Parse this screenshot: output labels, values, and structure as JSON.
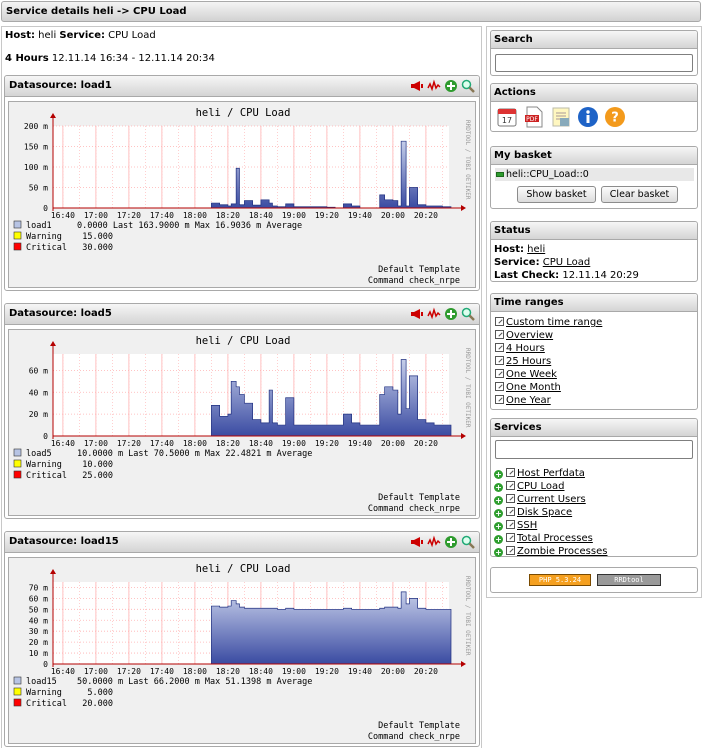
{
  "header": {
    "title": "Service details heli -> CPU Load"
  },
  "host": {
    "host_label": "Host:",
    "host_value": "heli",
    "service_label": "Service:",
    "service_value": "CPU Load"
  },
  "range": {
    "label": "4 Hours",
    "value": "12.11.14 16:34 - 12.11.14 20:34"
  },
  "datasources": [
    {
      "title": "Datasource: load1",
      "graph_title": "heli / CPU Load",
      "side_label": "RRDTOOL / TOBI OETIKER",
      "legend": [
        {
          "name": "load1",
          "color": "#b7c4e4",
          "text": "0.0000   Last   163.9000 m Max   16.9036 m Average"
        },
        {
          "name": "Warning",
          "color": "#ffff00",
          "text": "15.000"
        },
        {
          "name": "Critical",
          "color": "#ff0000",
          "text": "30.000"
        }
      ],
      "template": "Default Template",
      "command": "Command check_nrpe"
    },
    {
      "title": "Datasource: load5",
      "graph_title": "heli / CPU Load",
      "side_label": "RRDTOOL / TOBI OETIKER",
      "legend": [
        {
          "name": "load5",
          "color": "#b7c4e4",
          "text": "10.0000 m Last   70.5000 m Max   22.4821 m Average"
        },
        {
          "name": "Warning",
          "color": "#ffff00",
          "text": "10.000"
        },
        {
          "name": "Critical",
          "color": "#ff0000",
          "text": "25.000"
        }
      ],
      "template": "Default Template",
      "command": "Command check_nrpe"
    },
    {
      "title": "Datasource: load15",
      "graph_title": "heli / CPU Load",
      "side_label": "RRDTOOL / TOBI OETIKER",
      "legend": [
        {
          "name": "load15",
          "color": "#b7c4e4",
          "text": "50.0000 m Last   66.2000 m Max   51.1398 m Average"
        },
        {
          "name": "Warning",
          "color": "#ffff00",
          "text": "5.000"
        },
        {
          "name": "Critical",
          "color": "#ff0000",
          "text": "20.000"
        }
      ],
      "template": "Default Template",
      "command": "Command check_nrpe"
    }
  ],
  "chart_data": [
    {
      "type": "area",
      "title": "heli / CPU Load",
      "x_ticks": [
        "16:40",
        "17:00",
        "17:20",
        "17:40",
        "18:00",
        "18:20",
        "18:40",
        "19:00",
        "19:20",
        "19:40",
        "20:00",
        "20:20"
      ],
      "y_ticks": [
        "0",
        "50 m",
        "100 m",
        "150 m",
        "200 m"
      ],
      "ylim": [
        0,
        200
      ],
      "y_unit": "m",
      "grid": true,
      "series": [
        {
          "name": "load1",
          "x": [
            "18:10",
            "18:15",
            "18:20",
            "18:22",
            "18:25",
            "18:27",
            "18:30",
            "18:35",
            "18:40",
            "18:45",
            "18:47",
            "18:50",
            "18:55",
            "19:00",
            "19:20",
            "19:25",
            "19:30",
            "19:35",
            "19:40",
            "19:50",
            "19:52",
            "19:55",
            "20:00",
            "20:03",
            "20:05",
            "20:08",
            "20:10",
            "20:15",
            "20:20",
            "20:25",
            "20:30"
          ],
          "values": [
            12,
            8,
            5,
            10,
            97,
            8,
            18,
            7,
            20,
            12,
            5,
            3,
            10,
            3,
            2,
            0,
            10,
            5,
            0,
            0,
            32,
            20,
            18,
            5,
            163,
            5,
            50,
            8,
            5,
            5,
            3
          ]
        }
      ]
    },
    {
      "type": "area",
      "title": "heli / CPU Load",
      "x_ticks": [
        "16:40",
        "17:00",
        "17:20",
        "17:40",
        "18:00",
        "18:20",
        "18:40",
        "19:00",
        "19:20",
        "19:40",
        "20:00",
        "20:20"
      ],
      "y_ticks": [
        "0",
        "20 m",
        "40 m",
        "60 m"
      ],
      "ylim": [
        0,
        75
      ],
      "y_unit": "m",
      "grid": true,
      "series": [
        {
          "name": "load5",
          "x": [
            "18:10",
            "18:15",
            "18:20",
            "18:22",
            "18:25",
            "18:27",
            "18:30",
            "18:35",
            "18:40",
            "18:45",
            "18:47",
            "18:50",
            "18:55",
            "19:00",
            "19:20",
            "19:25",
            "19:30",
            "19:35",
            "19:40",
            "19:50",
            "19:52",
            "19:55",
            "20:00",
            "20:03",
            "20:05",
            "20:08",
            "20:10",
            "20:15",
            "20:20",
            "20:25",
            "20:30"
          ],
          "values": [
            28,
            18,
            20,
            50,
            45,
            38,
            30,
            15,
            12,
            42,
            12,
            10,
            35,
            10,
            10,
            10,
            20,
            12,
            10,
            10,
            38,
            45,
            42,
            20,
            70,
            25,
            55,
            15,
            12,
            10,
            10
          ]
        }
      ]
    },
    {
      "type": "area",
      "title": "heli / CPU Load",
      "x_ticks": [
        "16:40",
        "17:00",
        "17:20",
        "17:40",
        "18:00",
        "18:20",
        "18:40",
        "19:00",
        "19:20",
        "19:40",
        "20:00",
        "20:20"
      ],
      "y_ticks": [
        "0",
        "10 m",
        "20 m",
        "30 m",
        "40 m",
        "50 m",
        "60 m",
        "70 m"
      ],
      "ylim": [
        0,
        75
      ],
      "y_unit": "m",
      "grid": true,
      "series": [
        {
          "name": "load15",
          "x": [
            "18:10",
            "18:15",
            "18:20",
            "18:22",
            "18:25",
            "18:27",
            "18:30",
            "18:35",
            "18:40",
            "18:45",
            "18:47",
            "18:50",
            "18:55",
            "19:00",
            "19:20",
            "19:25",
            "19:30",
            "19:35",
            "19:40",
            "19:50",
            "19:52",
            "19:55",
            "20:00",
            "20:03",
            "20:05",
            "20:08",
            "20:10",
            "20:15",
            "20:20",
            "20:25",
            "20:30"
          ],
          "values": [
            53,
            52,
            53,
            58,
            55,
            52,
            51,
            51,
            51,
            51,
            51,
            50,
            51,
            50,
            50,
            50,
            51,
            50,
            50,
            50,
            51,
            52,
            52,
            51,
            66,
            55,
            60,
            51,
            50,
            50,
            50
          ]
        }
      ]
    }
  ],
  "sidebar": {
    "search": {
      "title": "Search",
      "placeholder": ""
    },
    "actions": {
      "title": "Actions"
    },
    "basket": {
      "title": "My basket",
      "item": "heli::CPU_Load::0",
      "show": "Show basket",
      "clear": "Clear basket"
    },
    "status": {
      "title": "Status",
      "host_label": "Host:",
      "host_value": "heli",
      "service_label": "Service:",
      "service_value": "CPU Load",
      "lastcheck_label": "Last Check:",
      "lastcheck_value": "12.11.14 20:29"
    },
    "timeranges": {
      "title": "Time ranges",
      "items": [
        "Custom time range",
        "Overview",
        "4 Hours",
        "25 Hours",
        "One Week",
        "One Month",
        "One Year"
      ]
    },
    "services": {
      "title": "Services",
      "items": [
        "Host Perfdata",
        "CPU Load",
        "Current Users",
        "Disk Space",
        "SSH",
        "Total Processes",
        "Zombie Processes"
      ]
    },
    "badges": {
      "php": "PHP 5.3.24",
      "rrd": "RRDtool"
    }
  },
  "colors": {
    "area_top": "#c5cde9",
    "area_bottom": "#3a4ba2",
    "grid": "#ffb0b0",
    "axis": "#b40000",
    "bg": "#f0f0f0"
  }
}
